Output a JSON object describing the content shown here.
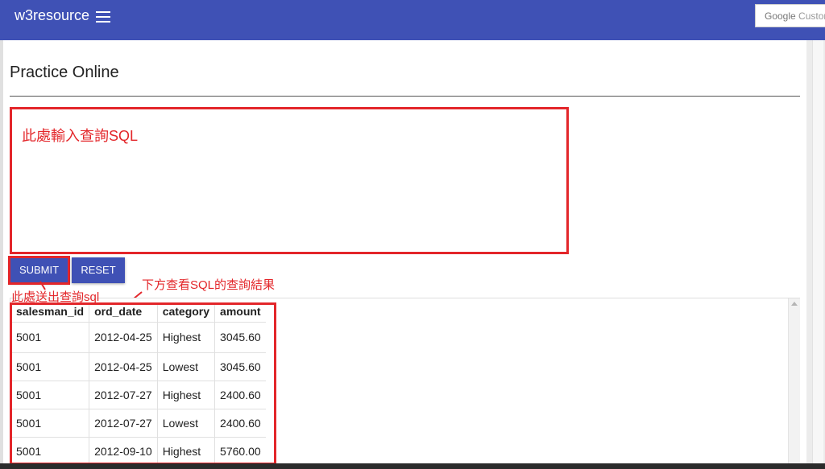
{
  "header": {
    "brand": "w3resource",
    "search_prefix": "Google",
    "search_rest": "Custom"
  },
  "page": {
    "title": "Practice Online"
  },
  "editor": {
    "annotation_text": "此處輸入查詢SQL"
  },
  "buttons": {
    "submit_label": "SUBMIT",
    "reset_label": "RESET"
  },
  "annotations": {
    "submit_note": "此處送出查詢sql",
    "result_note": "下方查看SQL的查詢結果"
  },
  "results": {
    "columns": [
      "salesman_id",
      "ord_date",
      "category",
      "amount"
    ],
    "rows": [
      [
        "5001",
        "2012-04-25",
        "Highest",
        "3045.60"
      ],
      [
        "5001",
        "2012-04-25",
        "Lowest",
        "3045.60"
      ],
      [
        "5001",
        "2012-07-27",
        "Highest",
        "2400.60"
      ],
      [
        "5001",
        "2012-07-27",
        "Lowest",
        "2400.60"
      ],
      [
        "5001",
        "2012-09-10",
        "Highest",
        "5760.00"
      ]
    ]
  },
  "colors": {
    "primary": "#3f51b5",
    "annotation_red": "#e3262a"
  },
  "icons": {
    "menu": "hamburger-menu-icon",
    "scroll_up": "scroll-up-arrow-icon"
  }
}
